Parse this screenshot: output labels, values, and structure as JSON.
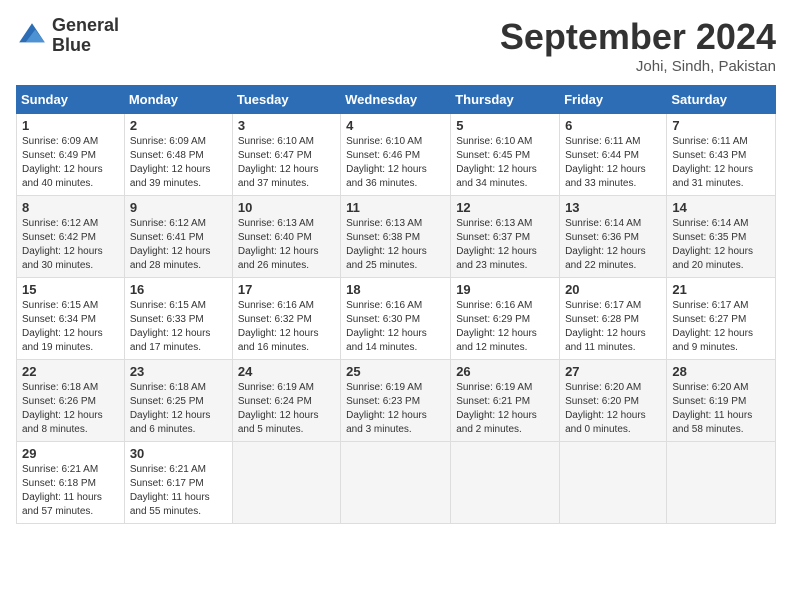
{
  "header": {
    "logo_line1": "General",
    "logo_line2": "Blue",
    "month_title": "September 2024",
    "location": "Johi, Sindh, Pakistan"
  },
  "weekdays": [
    "Sunday",
    "Monday",
    "Tuesday",
    "Wednesday",
    "Thursday",
    "Friday",
    "Saturday"
  ],
  "weeks": [
    [
      {
        "day": "1",
        "rise": "6:09 AM",
        "set": "6:49 PM",
        "daylight": "12 hours and 40 minutes."
      },
      {
        "day": "2",
        "rise": "6:09 AM",
        "set": "6:48 PM",
        "daylight": "12 hours and 39 minutes."
      },
      {
        "day": "3",
        "rise": "6:10 AM",
        "set": "6:47 PM",
        "daylight": "12 hours and 37 minutes."
      },
      {
        "day": "4",
        "rise": "6:10 AM",
        "set": "6:46 PM",
        "daylight": "12 hours and 36 minutes."
      },
      {
        "day": "5",
        "rise": "6:10 AM",
        "set": "6:45 PM",
        "daylight": "12 hours and 34 minutes."
      },
      {
        "day": "6",
        "rise": "6:11 AM",
        "set": "6:44 PM",
        "daylight": "12 hours and 33 minutes."
      },
      {
        "day": "7",
        "rise": "6:11 AM",
        "set": "6:43 PM",
        "daylight": "12 hours and 31 minutes."
      }
    ],
    [
      {
        "day": "8",
        "rise": "6:12 AM",
        "set": "6:42 PM",
        "daylight": "12 hours and 30 minutes."
      },
      {
        "day": "9",
        "rise": "6:12 AM",
        "set": "6:41 PM",
        "daylight": "12 hours and 28 minutes."
      },
      {
        "day": "10",
        "rise": "6:13 AM",
        "set": "6:40 PM",
        "daylight": "12 hours and 26 minutes."
      },
      {
        "day": "11",
        "rise": "6:13 AM",
        "set": "6:38 PM",
        "daylight": "12 hours and 25 minutes."
      },
      {
        "day": "12",
        "rise": "6:13 AM",
        "set": "6:37 PM",
        "daylight": "12 hours and 23 minutes."
      },
      {
        "day": "13",
        "rise": "6:14 AM",
        "set": "6:36 PM",
        "daylight": "12 hours and 22 minutes."
      },
      {
        "day": "14",
        "rise": "6:14 AM",
        "set": "6:35 PM",
        "daylight": "12 hours and 20 minutes."
      }
    ],
    [
      {
        "day": "15",
        "rise": "6:15 AM",
        "set": "6:34 PM",
        "daylight": "12 hours and 19 minutes."
      },
      {
        "day": "16",
        "rise": "6:15 AM",
        "set": "6:33 PM",
        "daylight": "12 hours and 17 minutes."
      },
      {
        "day": "17",
        "rise": "6:16 AM",
        "set": "6:32 PM",
        "daylight": "12 hours and 16 minutes."
      },
      {
        "day": "18",
        "rise": "6:16 AM",
        "set": "6:30 PM",
        "daylight": "12 hours and 14 minutes."
      },
      {
        "day": "19",
        "rise": "6:16 AM",
        "set": "6:29 PM",
        "daylight": "12 hours and 12 minutes."
      },
      {
        "day": "20",
        "rise": "6:17 AM",
        "set": "6:28 PM",
        "daylight": "12 hours and 11 minutes."
      },
      {
        "day": "21",
        "rise": "6:17 AM",
        "set": "6:27 PM",
        "daylight": "12 hours and 9 minutes."
      }
    ],
    [
      {
        "day": "22",
        "rise": "6:18 AM",
        "set": "6:26 PM",
        "daylight": "12 hours and 8 minutes."
      },
      {
        "day": "23",
        "rise": "6:18 AM",
        "set": "6:25 PM",
        "daylight": "12 hours and 6 minutes."
      },
      {
        "day": "24",
        "rise": "6:19 AM",
        "set": "6:24 PM",
        "daylight": "12 hours and 5 minutes."
      },
      {
        "day": "25",
        "rise": "6:19 AM",
        "set": "6:23 PM",
        "daylight": "12 hours and 3 minutes."
      },
      {
        "day": "26",
        "rise": "6:19 AM",
        "set": "6:21 PM",
        "daylight": "12 hours and 2 minutes."
      },
      {
        "day": "27",
        "rise": "6:20 AM",
        "set": "6:20 PM",
        "daylight": "12 hours and 0 minutes."
      },
      {
        "day": "28",
        "rise": "6:20 AM",
        "set": "6:19 PM",
        "daylight": "11 hours and 58 minutes."
      }
    ],
    [
      {
        "day": "29",
        "rise": "6:21 AM",
        "set": "6:18 PM",
        "daylight": "11 hours and 57 minutes."
      },
      {
        "day": "30",
        "rise": "6:21 AM",
        "set": "6:17 PM",
        "daylight": "11 hours and 55 minutes."
      },
      null,
      null,
      null,
      null,
      null
    ]
  ]
}
